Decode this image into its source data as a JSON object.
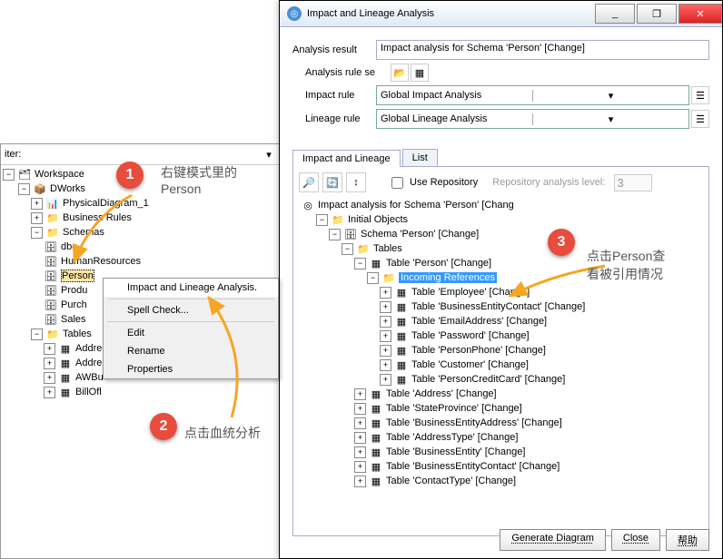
{
  "dialog": {
    "title": "Impact and Lineage Analysis",
    "analysis_result_label": "Analysis result",
    "analysis_result_value": "Impact analysis for Schema 'Person' [Change]",
    "analysis_rule_label": "Analysis rule se",
    "impact_rule_label": "Impact rule",
    "impact_rule_value": "Global Impact Analysis",
    "lineage_rule_label": "Lineage rule",
    "lineage_rule_value": "Global Lineage Analysis",
    "tabs": [
      {
        "label": "Impact and Lineage",
        "active": true
      },
      {
        "label": "List",
        "active": false
      }
    ],
    "use_repository_label": "Use Repository",
    "repo_level_label": "Repository analysis level:",
    "repo_level_value": "3",
    "tree_root": "Impact analysis for Schema 'Person' [Chang",
    "initial_objects": "Initial Objects",
    "schema_person": "Schema 'Person' [Change]",
    "tables_label": "Tables",
    "table_person": "Table 'Person' [Change]",
    "incoming_refs": "Incoming References",
    "ref_tables": [
      "Table 'Employee' [Change]",
      "Table 'BusinessEntityContact' [Change]",
      "Table 'EmailAddress' [Change]",
      "Table 'Password' [Change]",
      "Table 'PersonPhone' [Change]",
      "Table 'Customer' [Change]",
      "Table 'PersonCreditCard' [Change]"
    ],
    "other_tables": [
      "Table 'Address' [Change]",
      "Table 'StateProvince' [Change]",
      "Table 'BusinessEntityAddress' [Change]",
      "Table 'AddressType' [Change]",
      "Table 'BusinessEntity' [Change]",
      "Table 'BusinessEntityContact' [Change]",
      "Table 'ContactType' [Change]"
    ],
    "buttons": {
      "generate": "Generate Diagram",
      "close": "Close",
      "help": "帮助"
    }
  },
  "left": {
    "filter_label": "iter:",
    "root": "Workspace",
    "dworks": "DWorks",
    "items": [
      "PhysicalDiagram_1",
      "Business Rules",
      "Schemas"
    ],
    "schemas": [
      "dbo",
      "HumanResources",
      "Person",
      "Produ",
      "Purch",
      "Sales"
    ],
    "tables_label": "Tables",
    "tables": [
      "Addre",
      "Addre",
      "AWBu",
      "BillOfl"
    ]
  },
  "context_menu": [
    "Impact and Lineage Analysis.",
    "Spell Check...",
    "Edit",
    "Rename",
    "Properties"
  ],
  "annotations": {
    "a1": "右键模式里的\nPerson",
    "a2": "点击血统分析",
    "a3": "点击Person查\n看被引用情况"
  },
  "badges": [
    "1",
    "2",
    "3"
  ]
}
